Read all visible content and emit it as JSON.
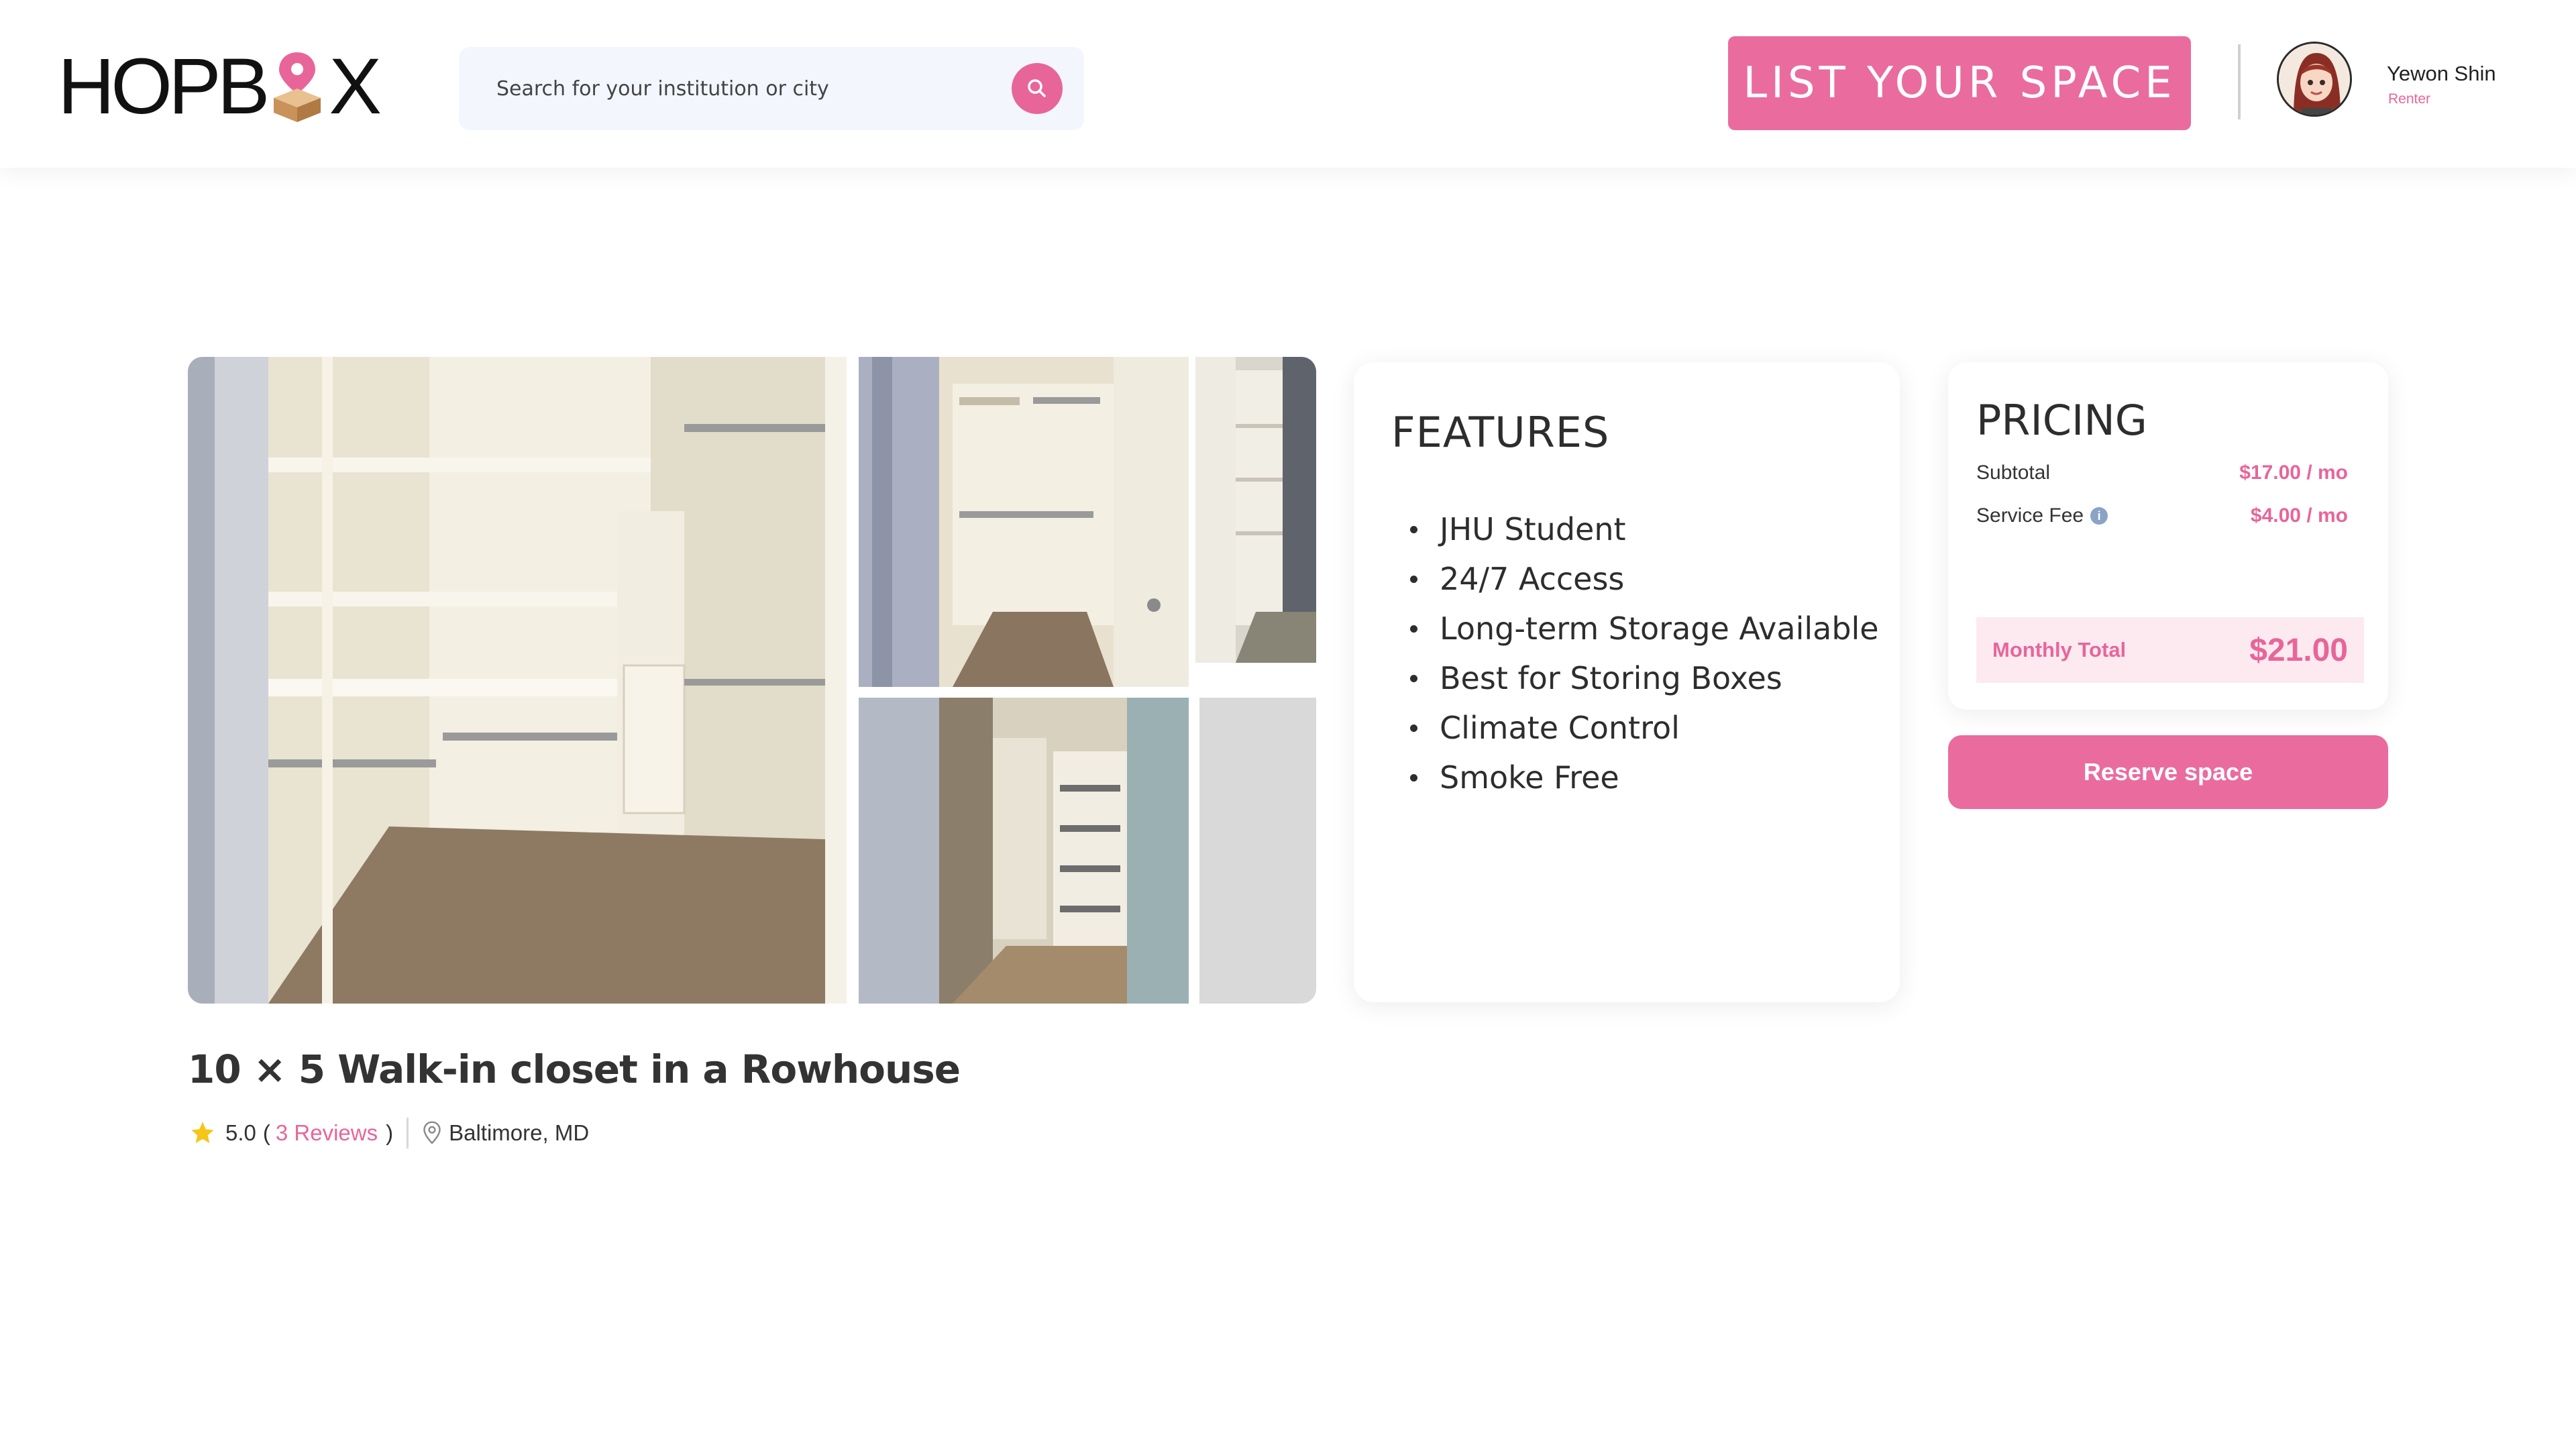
{
  "brand": {
    "logo_prefix": "HOPB",
    "logo_suffix": "X",
    "accent": "#ea6c9e"
  },
  "search": {
    "placeholder": "Search for your institution or city"
  },
  "header": {
    "list_space_label": "LIST YOUR SPACE"
  },
  "user": {
    "name": "Yewon Shin",
    "role": "Renter"
  },
  "listing": {
    "title": "10 × 5 Walk-in closet in a Rowhouse",
    "rating": "5.0",
    "reviews_open": "(",
    "reviews_label": "3 Reviews",
    "reviews_close": ")",
    "location": "Baltimore, MD"
  },
  "features": {
    "heading": "FEATURES",
    "items": [
      "JHU Student",
      "24/7 Access",
      "Long-term Storage Available",
      "Best for Storing Boxes",
      "Climate Control",
      "Smoke Free"
    ]
  },
  "pricing": {
    "heading": "PRICING",
    "subtotal_label": "Subtotal",
    "subtotal_value": "$17.00 / mo",
    "service_fee_label": "Service Fee",
    "service_fee_value": "$4.00 / mo",
    "total_label": "Monthly Total",
    "total_value": "$21.00",
    "reserve_label": "Reserve space"
  },
  "icons": [
    "search-icon",
    "map-pin-icon",
    "star-icon",
    "location-icon",
    "info-icon",
    "avatar"
  ]
}
